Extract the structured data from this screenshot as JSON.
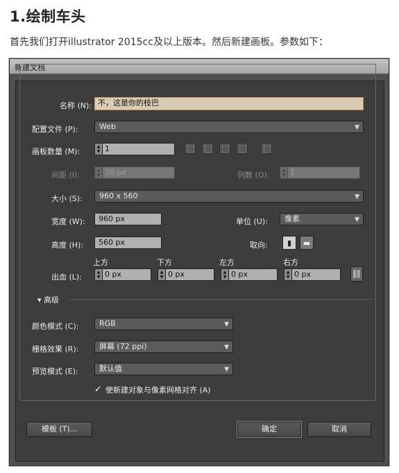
{
  "article": {
    "heading": "1.绘制车头",
    "paragraph": "首先我们打开illustrator 2015cc及以上版本。然后新建画板。参数如下："
  },
  "dialog": {
    "title": "新建文档",
    "name_label": "名称 (N):",
    "name_value": "不，这是你的枝巴",
    "profile_label": "配置文件 (P):",
    "profile_value": "Web",
    "artboards_label": "画板数量 (M):",
    "artboards_value": "1",
    "spacing_label": "间距 (I):",
    "spacing_value": "20 px",
    "columns_label": "列数 (O):",
    "columns_value": "1",
    "size_label": "大小 (S):",
    "size_value": "960 x 560",
    "width_label": "宽度 (W):",
    "width_value": "960 px",
    "units_label": "单位 (U):",
    "units_value": "像素",
    "height_label": "高度 (H):",
    "height_value": "560 px",
    "orientation_label": "取向:",
    "bleed_label": "出血 (L):",
    "bleed_top_label": "上方",
    "bleed_bottom_label": "下方",
    "bleed_left_label": "左方",
    "bleed_right_label": "右方",
    "bleed_top": "0 px",
    "bleed_bottom": "0 px",
    "bleed_left": "0 px",
    "bleed_right": "0 px",
    "advanced_label": "高级",
    "color_mode_label": "颜色模式 (C):",
    "color_mode_value": "RGB",
    "raster_label": "栅格效果 (R):",
    "raster_value": "屏幕 (72 ppi)",
    "preview_label": "预览模式 (E):",
    "preview_value": "默认值",
    "align_checkbox_label": "使新建对象与像素网格对齐 (A)",
    "align_checked": true,
    "templates_button": "模板 (T)...",
    "ok_button": "确定",
    "cancel_button": "取消"
  }
}
